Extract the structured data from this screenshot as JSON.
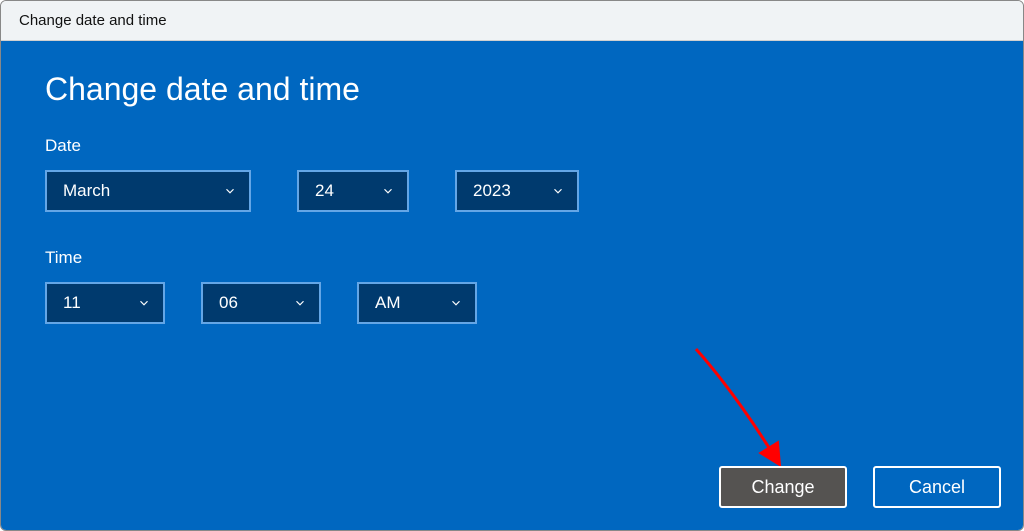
{
  "titlebar": {
    "text": "Change date and time"
  },
  "heading": "Change date and time",
  "date": {
    "label": "Date",
    "month": "March",
    "day": "24",
    "year": "2023"
  },
  "time": {
    "label": "Time",
    "hour": "11",
    "minute": "06",
    "ampm": "AM"
  },
  "buttons": {
    "change": "Change",
    "cancel": "Cancel"
  }
}
